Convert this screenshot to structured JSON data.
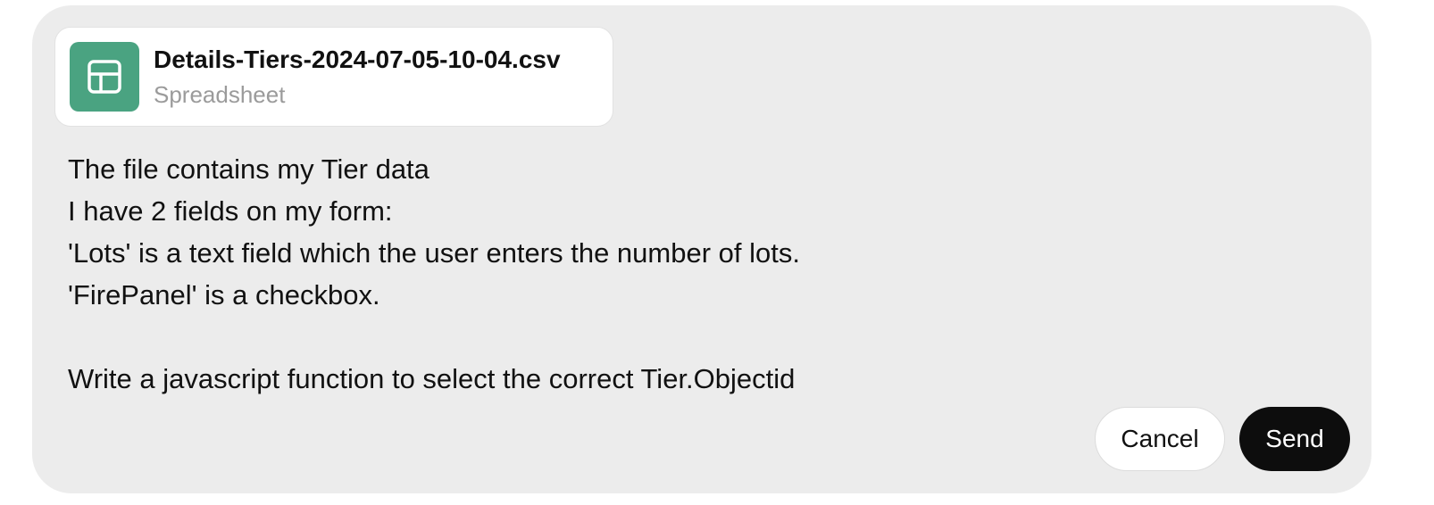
{
  "attachment": {
    "file_name": "Details-Tiers-2024-07-05-10-04.csv",
    "file_type": "Spreadsheet",
    "icon": "spreadsheet-icon",
    "icon_color": "#4aa381"
  },
  "message": {
    "lines": [
      "The file contains my Tier data",
      "I have 2 fields on my form:",
      "'Lots' is a text field which the user enters the number of lots.",
      "'FirePanel' is a checkbox.",
      "",
      "Write a javascript function to select the correct Tier.Objectid"
    ]
  },
  "actions": {
    "cancel_label": "Cancel",
    "send_label": "Send"
  }
}
